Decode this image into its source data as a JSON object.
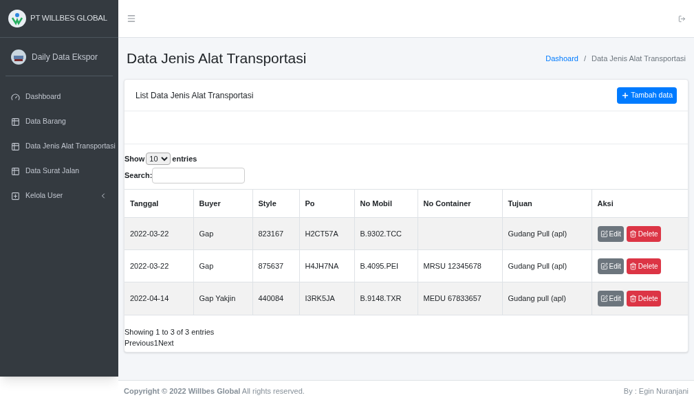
{
  "brand": {
    "title": "PT WILLBES GLOBAL"
  },
  "user": {
    "name": "Daily Data Ekspor"
  },
  "sidebar": {
    "items": [
      {
        "kind": "dashboard",
        "label": "Dashboard",
        "selected": false
      },
      {
        "kind": "table",
        "label": "Data Barang",
        "selected": false
      },
      {
        "kind": "table",
        "label": "Data Jenis Alat Transportasi",
        "selected": false
      },
      {
        "kind": "table",
        "label": "Data Surat Jalan",
        "selected": false
      },
      {
        "kind": "tree",
        "label": "Kelola User",
        "selected": false,
        "expanded": false
      }
    ]
  },
  "page": {
    "title": "Data Jenis Alat Transportasi",
    "breadcrumb": [
      "Dashoard",
      "Data Jenis Alat Transportasi"
    ],
    "breadcrumb_separator": "/"
  },
  "card": {
    "title": "List Data Jenis Alat Transportasi",
    "add_button": "Tambah data"
  },
  "table_controls": {
    "show_label": "Show",
    "page_size": "10",
    "entries_label": "entries",
    "search_label": "Search:"
  },
  "table": {
    "columns": [
      "Tanggal",
      "Buyer",
      "Style",
      "Po",
      "No Mobil",
      "No Container",
      "Tujuan",
      "Aksi"
    ],
    "rows": [
      {
        "cells": [
          "2022-03-22",
          "Gap",
          "823167",
          "H2CT57A",
          "B.9302.TCC",
          "",
          "Gudang Pull (apl)"
        ],
        "actions": [
          "Edit",
          "Delete"
        ]
      },
      {
        "cells": [
          "2022-03-22",
          "Gap",
          "875637",
          "H4JH7NA",
          "B.4095.PEI",
          "MRSU 12345678",
          "Gudang Pull (apl)"
        ],
        "actions": [
          "Edit",
          "Delete"
        ]
      },
      {
        "cells": [
          "2022-04-14",
          "Gap Yakjin",
          "440084",
          "I3RK5JA",
          "B.9148.TXR",
          "MEDU 67833657",
          "Gudang pull (apl)"
        ],
        "actions": [
          "Edit",
          "Delete"
        ]
      }
    ]
  },
  "table_info": "Showing 1 to 3 of 3 entries",
  "pagination": [
    "Previous",
    "1",
    "Next"
  ],
  "footer": {
    "copyright": "**Copyright © 2022 Willbes Global** All rights reserved.",
    "author": "By : Egin Nuranjani"
  }
}
